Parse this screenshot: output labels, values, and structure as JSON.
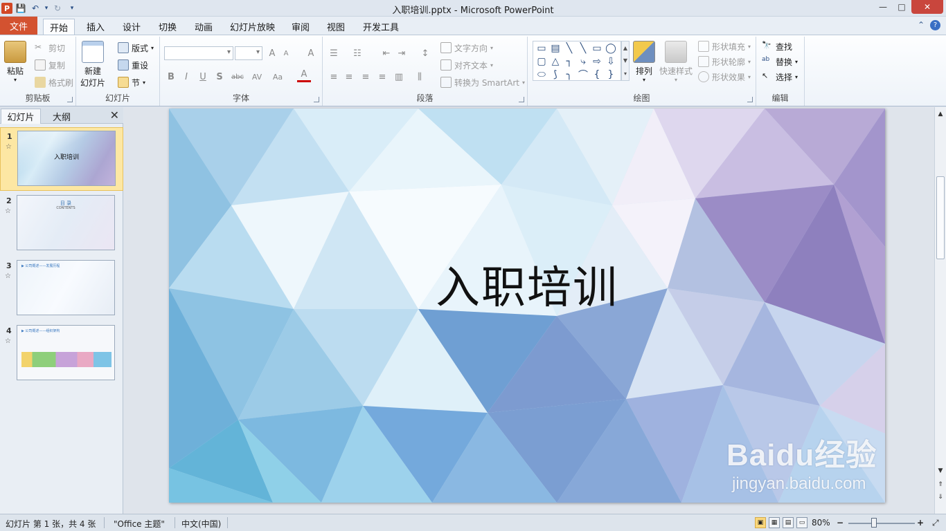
{
  "window": {
    "title": "入职培训.pptx - Microsoft PowerPoint",
    "min": "—",
    "max": "□",
    "close": "✕"
  },
  "qat": {
    "app_icon": "P",
    "save": "💾",
    "undo": "↶",
    "undo_arrow": "▾",
    "redo": "↻",
    "customize": "▾"
  },
  "tabs": {
    "file": "文件",
    "items": [
      "开始",
      "插入",
      "设计",
      "切换",
      "动画",
      "幻灯片放映",
      "审阅",
      "视图",
      "开发工具"
    ],
    "help": "?",
    "collapse": "⌃"
  },
  "ribbon": {
    "clipboard": {
      "label": "剪贴板",
      "paste": "粘贴",
      "cut": "剪切",
      "copy": "复制",
      "painter": "格式刷"
    },
    "slides": {
      "label": "幻灯片",
      "new_slide": "新建",
      "new_slide2": "幻灯片",
      "layout": "版式",
      "reset": "重设",
      "section": "节"
    },
    "font": {
      "label": "字体",
      "grow": "A",
      "shrink": "A",
      "clear": "A",
      "bold": "B",
      "italic": "I",
      "underline": "U",
      "shadow": "S",
      "strike": "abc",
      "spacing": "AV",
      "case": "Aa",
      "color": "A"
    },
    "paragraph": {
      "label": "段落",
      "text_direction": "文字方向",
      "align_text": "对齐文本",
      "smartart": "转换为 SmartArt"
    },
    "drawing": {
      "label": "绘图",
      "arrange": "排列",
      "quick_styles": "快速样式",
      "shape_fill": "形状填充",
      "shape_outline": "形状轮廓",
      "shape_effects": "形状效果",
      "shapes": [
        "▭",
        "▤",
        "╲",
        "╲",
        "▭",
        "◯",
        "▢",
        "△",
        "┐",
        "⤷",
        "⇨",
        "⇩",
        "⬭",
        "⟆",
        "╮",
        "⌒",
        "{",
        "}"
      ]
    },
    "editing": {
      "label": "编辑",
      "find": "查找",
      "replace": "替换",
      "select": "选择"
    }
  },
  "pane": {
    "tab_slides": "幻灯片",
    "tab_outline": "大纲",
    "close": "✕",
    "thumbs": [
      {
        "num": "1",
        "star": "☆",
        "text": "入职培训"
      },
      {
        "num": "2",
        "star": "☆",
        "text": "目 录",
        "sub": "CONTENTS"
      },
      {
        "num": "3",
        "star": "☆",
        "text": "▶ 公司概述——发展历程"
      },
      {
        "num": "4",
        "star": "☆",
        "text": "▶ 公司概述——组织架构"
      }
    ]
  },
  "slide": {
    "title": "入职培训"
  },
  "watermark": {
    "brand": "Baidu经验",
    "url": "jingyan.baidu.com"
  },
  "scrollbar": {
    "up": "▲",
    "down": "▼",
    "prev": "⇑",
    "next": "⇓"
  },
  "status": {
    "slide_info": "幻灯片 第 1 张，共 4 张",
    "theme": "\"Office 主题\"",
    "language": "中文(中国)",
    "zoom": "80%",
    "zoom_minus": "−",
    "zoom_plus": "+",
    "fit": "⤢"
  }
}
